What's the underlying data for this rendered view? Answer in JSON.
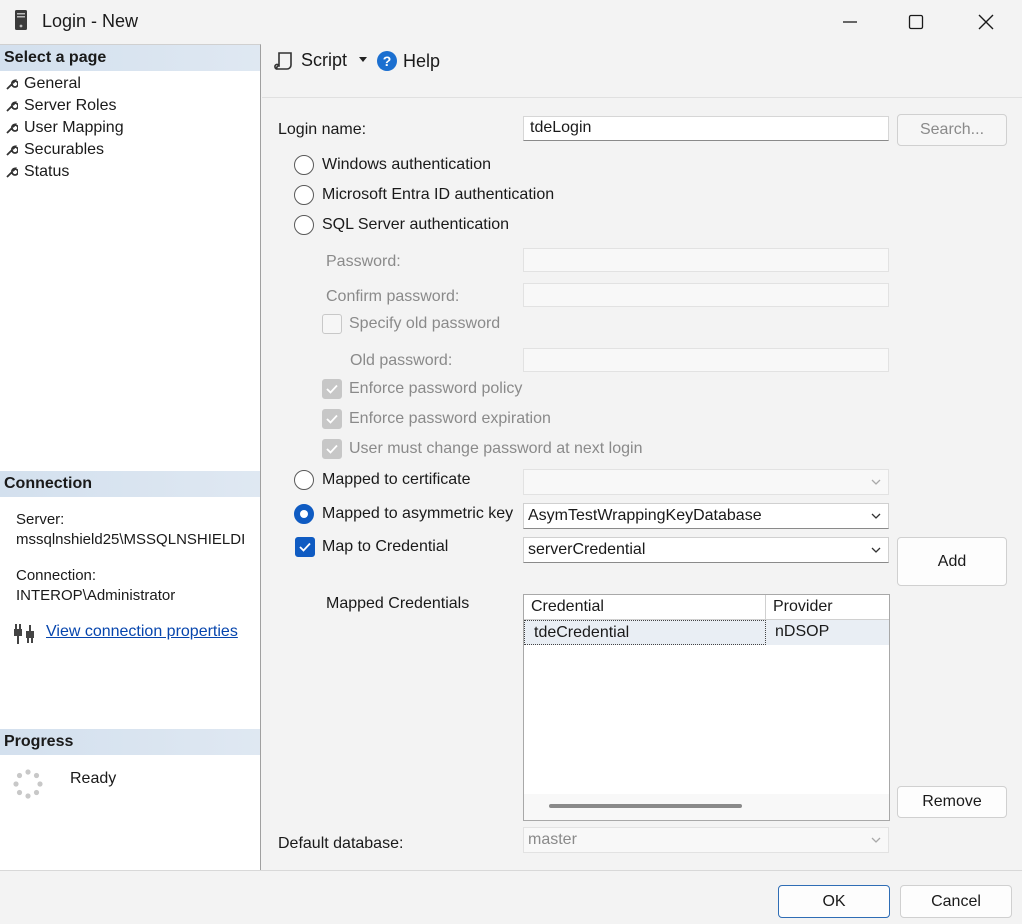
{
  "window": {
    "title": "Login - New",
    "icons": {
      "app": "server-icon",
      "minimize": "minimize-icon",
      "maximize": "maximize-icon",
      "close": "close-icon"
    }
  },
  "left": {
    "select_page_header": "Select a page",
    "pages": [
      {
        "label": "General",
        "icon": "wrench-icon",
        "selected": true
      },
      {
        "label": "Server Roles",
        "icon": "wrench-icon"
      },
      {
        "label": "User Mapping",
        "icon": "wrench-icon"
      },
      {
        "label": "Securables",
        "icon": "wrench-icon"
      },
      {
        "label": "Status",
        "icon": "wrench-icon"
      }
    ],
    "connection_header": "Connection",
    "server_label": "Server:",
    "server_value": "mssqlnshield25\\MSSQLNSHIELDI",
    "connection_label": "Connection:",
    "connection_value": "INTEROP\\Administrator",
    "view_props_link": "View connection properties",
    "progress_header": "Progress",
    "progress_status": "Ready"
  },
  "toolbar": {
    "script_label": "Script",
    "help_label": "Help"
  },
  "form": {
    "login_name_label": "Login name:",
    "login_name_value": "tdeLogin",
    "search_button": "Search...",
    "auth": {
      "windows": "Windows authentication",
      "entra": "Microsoft Entra ID authentication",
      "sql": "SQL Server authentication"
    },
    "password_label": "Password:",
    "confirm_password_label": "Confirm password:",
    "specify_old_password": "Specify old password",
    "old_password_label": "Old password:",
    "enforce_policy": "Enforce password policy",
    "enforce_expiration": "Enforce password expiration",
    "must_change": "User must change password at next login",
    "mapped_certificate": "Mapped to certificate",
    "mapped_certificate_value": "",
    "mapped_asym_key": "Mapped to asymmetric key",
    "mapped_asym_key_value": "AsymTestWrappingKeyDatabase",
    "map_credential": "Map to Credential",
    "map_credential_value": "serverCredential",
    "add_button": "Add",
    "mapped_credentials_label": "Mapped Credentials",
    "credentials_grid": {
      "columns": [
        "Credential",
        "Provider"
      ],
      "rows": [
        {
          "credential": "tdeCredential",
          "provider": "nDSOP"
        }
      ]
    },
    "remove_button": "Remove",
    "default_database_label": "Default database:",
    "default_database_value": "master"
  },
  "footer": {
    "ok_button": "OK",
    "cancel_button": "Cancel"
  },
  "colors": {
    "accent": "#0f5bc2",
    "link": "#0645ad",
    "section_header": "#d3e0ee"
  }
}
